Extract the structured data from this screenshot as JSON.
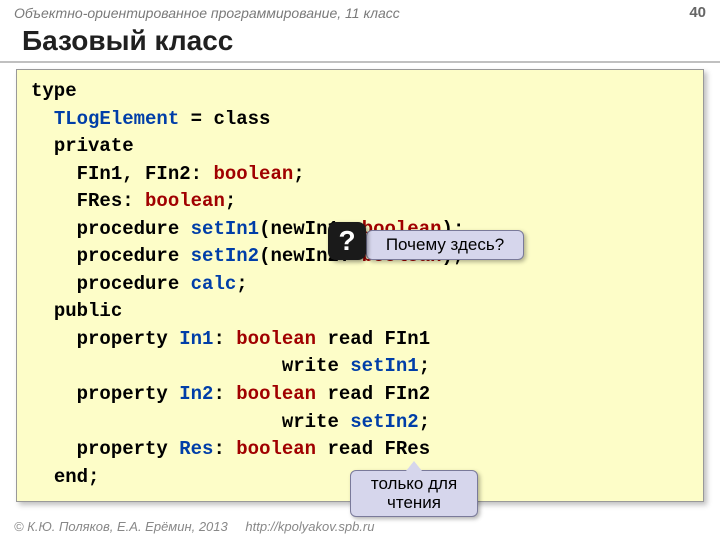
{
  "header": {
    "course": "Объектно-ориентированное программирование, 11 класс",
    "page": "40"
  },
  "title": "Базовый класс",
  "code": {
    "l1_type": "type",
    "l2_class": "TLogElement",
    "l2_eq": " = class",
    "l3_private": "private",
    "l4_a": "FIn1, FIn2: ",
    "l4_b": "boolean",
    "l4_c": ";",
    "l5_a": "FRes: ",
    "l5_b": "boolean",
    "l5_c": ";",
    "l6_a": "procedure ",
    "l6_b": "setIn1",
    "l6_c": "(newIn1: ",
    "l6_d": "boolean",
    "l6_e": ");",
    "l7_a": "procedure ",
    "l7_b": "setIn2",
    "l7_c": "(newIn2: ",
    "l7_d": "boolean",
    "l7_e": ");",
    "l8_a": "procedure ",
    "l8_b": "calc",
    "l8_c": ";",
    "l9_public": "public",
    "l10_a": "property ",
    "l10_b": "In1",
    "l10_c": ": ",
    "l10_d": "boolean",
    "l10_e": " read FIn1",
    "l11_a": "write ",
    "l11_b": "setIn1",
    "l11_c": ";",
    "l12_a": "property ",
    "l12_b": "In2",
    "l12_c": ": ",
    "l12_d": "boolean",
    "l12_e": " read FIn2",
    "l13_a": "write ",
    "l13_b": "setIn2",
    "l13_c": ";",
    "l14_a": "property ",
    "l14_b": "Res",
    "l14_c": ": ",
    "l14_d": "boolean",
    "l14_e": " read FRes",
    "l15_end": "end;"
  },
  "callouts": {
    "q": "?",
    "why_here": "Почему здесь?",
    "readonly": "только для чтения"
  },
  "footer": {
    "copyright": "© К.Ю. Поляков, Е.А. Ерёмин, 2013",
    "url": "http://kpolyakov.spb.ru"
  }
}
